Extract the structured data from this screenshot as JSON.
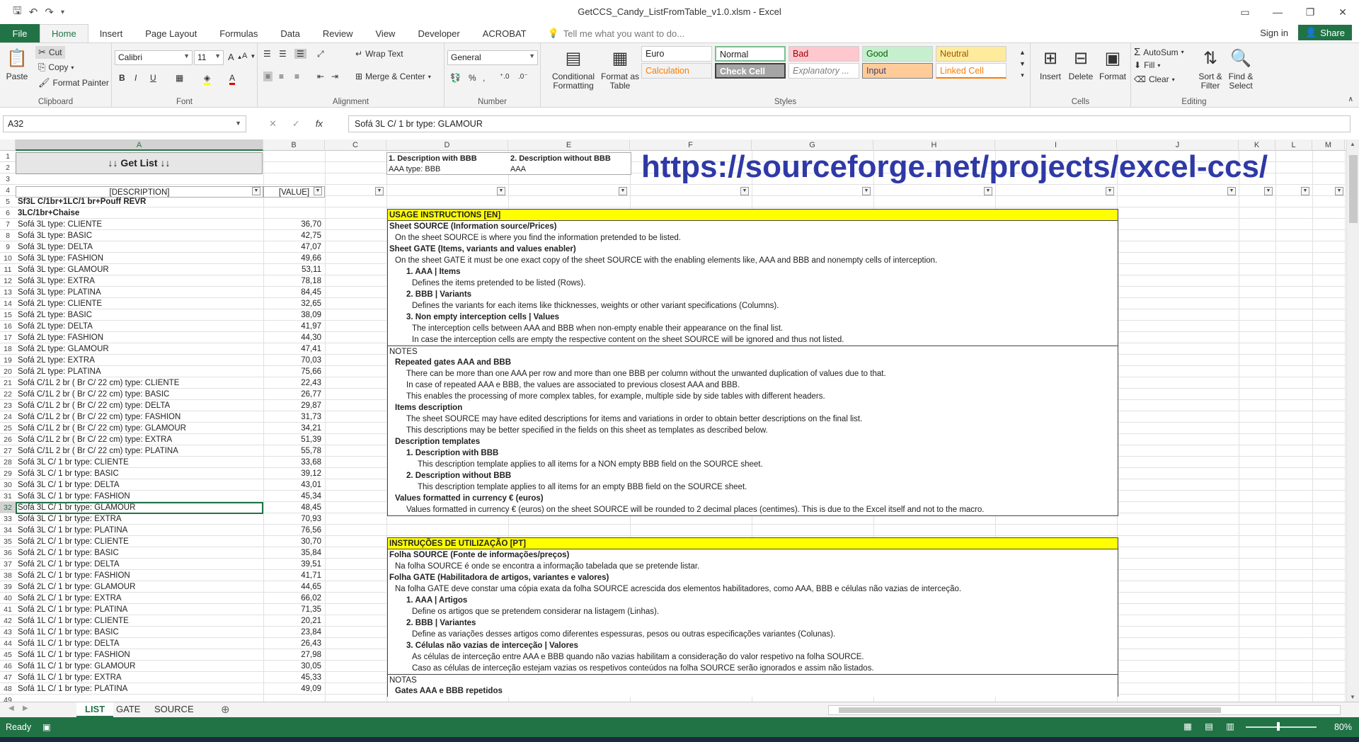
{
  "title": "GetCCS_Candy_ListFromTable_v1.0.xlsm - Excel",
  "tabs": {
    "file": "File",
    "items": [
      "Home",
      "Insert",
      "Page Layout",
      "Formulas",
      "Data",
      "Review",
      "View",
      "Developer",
      "ACROBAT"
    ],
    "tellme": "Tell me what you want to do...",
    "signin": "Sign in",
    "share": "Share"
  },
  "ribbon": {
    "clipboard": {
      "paste": "Paste",
      "cut": "Cut",
      "copy": "Copy",
      "painter": "Format Painter",
      "label": "Clipboard"
    },
    "font": {
      "name": "Calibri",
      "size": "11",
      "label": "Font"
    },
    "alignment": {
      "wrap": "Wrap Text",
      "merge": "Merge & Center",
      "label": "Alignment"
    },
    "number": {
      "format": "General",
      "label": "Number"
    },
    "styles": {
      "cond": "Conditional Formatting",
      "table": "Format as Table",
      "label": "Styles",
      "cells": [
        {
          "t": "Euro",
          "bg": "#ffffff",
          "fg": "#222222"
        },
        {
          "t": "Normal",
          "bg": "#ffffff",
          "fg": "#222222"
        },
        {
          "t": "Bad",
          "bg": "#ffc7ce",
          "fg": "#9c0006"
        },
        {
          "t": "Good",
          "bg": "#c6efce",
          "fg": "#006100"
        },
        {
          "t": "Neutral",
          "bg": "#ffeb9c",
          "fg": "#9c5700"
        },
        {
          "t": "Calculation",
          "bg": "#f2f2f2",
          "fg": "#fa7d00"
        },
        {
          "t": "Check Cell",
          "bg": "#a5a5a5",
          "fg": "#ffffff"
        },
        {
          "t": "Explanatory ...",
          "bg": "#ffffff",
          "fg": "#7f7f7f"
        },
        {
          "t": "Input",
          "bg": "#ffcc99",
          "fg": "#3f3f76"
        },
        {
          "t": "Linked Cell",
          "bg": "#ffffff",
          "fg": "#fa7d00"
        }
      ]
    },
    "cells": {
      "insert": "Insert",
      "delete": "Delete",
      "format": "Format",
      "label": "Cells"
    },
    "editing": {
      "autosum": "AutoSum",
      "fill": "Fill",
      "clear": "Clear",
      "sort": "Sort & Filter",
      "find": "Find & Select",
      "label": "Editing"
    }
  },
  "formula": {
    "namebox": "A32",
    "content": "Sofá 3L C/ 1 br type: GLAMOUR"
  },
  "columns": [
    "A",
    "B",
    "C",
    "D",
    "E",
    "F",
    "G",
    "H",
    "I",
    "J",
    "K",
    "L",
    "M"
  ],
  "header": {
    "getlist": "↓↓  Get List  ↓↓",
    "desc_label": "[DESCRIPTION]",
    "value_label": "[VALUE]",
    "d1": "1. Description with BBB",
    "d1v": "AAA type: BBB",
    "e1": "2. Description without BBB",
    "e1v": "AAA"
  },
  "url": "https://sourceforge.net/projects/excel-ccs/",
  "rows": [
    {
      "a": "Sf3L C/1br+1LC/1 br+Pouff REVR",
      "b": "",
      "bold": true
    },
    {
      "a": "3LC/1br+Chaise",
      "b": "",
      "bold": true
    },
    {
      "a": "Sofá 3L type: CLIENTE",
      "b": "36,70"
    },
    {
      "a": "Sofá 3L type: BASIC",
      "b": "42,75"
    },
    {
      "a": "Sofá 3L type: DELTA",
      "b": "47,07"
    },
    {
      "a": "Sofá 3L type: FASHION",
      "b": "49,66"
    },
    {
      "a": "Sofá 3L type: GLAMOUR",
      "b": "53,11"
    },
    {
      "a": "Sofá 3L type: EXTRA",
      "b": "78,18"
    },
    {
      "a": "Sofá 3L type: PLATINA",
      "b": "84,45"
    },
    {
      "a": "Sofá 2L type: CLIENTE",
      "b": "32,65"
    },
    {
      "a": "Sofá 2L type: BASIC",
      "b": "38,09"
    },
    {
      "a": "Sofá 2L type: DELTA",
      "b": "41,97"
    },
    {
      "a": "Sofá 2L type: FASHION",
      "b": "44,30"
    },
    {
      "a": "Sofá 2L type: GLAMOUR",
      "b": "47,41"
    },
    {
      "a": "Sofá 2L type: EXTRA",
      "b": "70,03"
    },
    {
      "a": "Sofá 2L type: PLATINA",
      "b": "75,66"
    },
    {
      "a": "Sofá C/1L 2 br ( Br C/ 22 cm) type: CLIENTE",
      "b": "22,43"
    },
    {
      "a": "Sofá C/1L 2 br ( Br C/ 22 cm) type: BASIC",
      "b": "26,77"
    },
    {
      "a": "Sofá C/1L 2 br ( Br C/ 22 cm) type: DELTA",
      "b": "29,87"
    },
    {
      "a": "Sofá C/1L 2 br ( Br C/ 22 cm) type: FASHION",
      "b": "31,73"
    },
    {
      "a": "Sofá C/1L 2 br ( Br C/ 22 cm) type: GLAMOUR",
      "b": "34,21"
    },
    {
      "a": "Sofá C/1L 2 br ( Br C/ 22 cm) type: EXTRA",
      "b": "51,39"
    },
    {
      "a": "Sofá C/1L 2 br ( Br C/ 22 cm) type: PLATINA",
      "b": "55,78"
    },
    {
      "a": "Sofá 3L C/ 1 br type: CLIENTE",
      "b": "33,68"
    },
    {
      "a": "Sofá 3L C/ 1 br type: BASIC",
      "b": "39,12"
    },
    {
      "a": "Sofá 3L C/ 1 br type: DELTA",
      "b": "43,01"
    },
    {
      "a": "Sofá 3L C/ 1 br type: FASHION",
      "b": "45,34"
    },
    {
      "a": "Sofá 3L C/ 1 br type: GLAMOUR",
      "b": "48,45"
    },
    {
      "a": "Sofá 3L C/ 1 br type: EXTRA",
      "b": "70,93"
    },
    {
      "a": "Sofá 3L C/ 1 br type: PLATINA",
      "b": "76,56"
    },
    {
      "a": "Sofá 2L C/ 1 br type: CLIENTE",
      "b": "30,70"
    },
    {
      "a": "Sofá 2L C/ 1 br type: BASIC",
      "b": "35,84"
    },
    {
      "a": "Sofá 2L C/ 1 br type: DELTA",
      "b": "39,51"
    },
    {
      "a": "Sofá 2L C/ 1 br type: FASHION",
      "b": "41,71"
    },
    {
      "a": "Sofá 2L C/ 1 br type: GLAMOUR",
      "b": "44,65"
    },
    {
      "a": "Sofá 2L C/ 1 br type: EXTRA",
      "b": "66,02"
    },
    {
      "a": "Sofá 2L C/ 1 br type: PLATINA",
      "b": "71,35"
    },
    {
      "a": "Sofá 1L C/ 1 br type: CLIENTE",
      "b": "20,21"
    },
    {
      "a": "Sofá 1L C/ 1 br type: BASIC",
      "b": "23,84"
    },
    {
      "a": "Sofá 1L C/ 1 br type: DELTA",
      "b": "26,43"
    },
    {
      "a": "Sofá 1L C/ 1 br type: FASHION",
      "b": "27,98"
    },
    {
      "a": "Sofá 1L C/ 1 br type: GLAMOUR",
      "b": "30,05"
    },
    {
      "a": "Sofá 1L C/ 1 br type: EXTRA",
      "b": "45,33"
    },
    {
      "a": "Sofá 1L C/ 1 br type: PLATINA",
      "b": "49,09"
    }
  ],
  "instructions_en": {
    "title": "USAGE INSTRUCTIONS [EN]",
    "lines": [
      {
        "t": "Sheet SOURCE (Information source/Prices)",
        "i": 0,
        "b": true
      },
      {
        "t": "On the sheet SOURCE is where you find the information pretended to be listed.",
        "i": 1
      },
      {
        "t": "Sheet GATE (Items, variants and values enabler)",
        "i": 0,
        "b": true
      },
      {
        "t": "On the sheet GATE it must be one exact copy of the sheet SOURCE with the enabling elements like, AAA and BBB and nonempty cells of interception.",
        "i": 1
      },
      {
        "t": "1. AAA | Items",
        "i": 3,
        "b": true
      },
      {
        "t": "Defines the items pretended to be listed (Rows).",
        "i": 4
      },
      {
        "t": "2. BBB | Variants",
        "i": 3,
        "b": true
      },
      {
        "t": "Defines the variants for each items like thicknesses, weights or other variant specifications (Columns).",
        "i": 4
      },
      {
        "t": "3. Non empty interception cells | Values",
        "i": 3,
        "b": true
      },
      {
        "t": "The interception cells between AAA and BBB when non-empty enable their appearance on the final list.",
        "i": 4
      },
      {
        "t": "In case the interception cells are empty the respective content on the sheet SOURCE will be ignored and thus not listed.",
        "i": 4
      },
      {
        "t": "NOTES",
        "i": 0,
        "sep": true
      },
      {
        "t": "Repeated gates AAA and BBB",
        "i": 1,
        "b": true
      },
      {
        "t": "There can be more than one AAA per row and more than one BBB per column without the unwanted duplication of values due to that.",
        "i": 3
      },
      {
        "t": "In case of repeated AAA e BBB, the values are associated to previous closest AAA and BBB.",
        "i": 3
      },
      {
        "t": "This enables the processing of more complex tables, for example, multiple side by side tables with different headers.",
        "i": 3
      },
      {
        "t": "Items description",
        "i": 1,
        "b": true
      },
      {
        "t": "The sheet SOURCE may have edited descriptions for items and variations in order to obtain better descriptions on the final list.",
        "i": 3
      },
      {
        "t": "This descriptions may be better specified in the fields on this sheet as templates as described below.",
        "i": 3
      },
      {
        "t": "Description templates",
        "i": 1,
        "b": true
      },
      {
        "t": "1. Description with BBB",
        "i": 3,
        "b": true
      },
      {
        "t": "This description template applies to all items for a NON empty BBB field on the SOURCE sheet.",
        "i": 5
      },
      {
        "t": "2. Description without BBB",
        "i": 3,
        "b": true
      },
      {
        "t": "This description template applies to all items for an empty BBB field on the SOURCE sheet.",
        "i": 5
      },
      {
        "t": "Values formatted in currency € (euros)",
        "i": 1,
        "b": true
      },
      {
        "t": "Values formatted in currency € (euros) on the sheet SOURCE will be rounded to 2 decimal places (centimes). This is due to the Excel itself and not to the macro.",
        "i": 3
      }
    ]
  },
  "instructions_pt": {
    "title": "INSTRUÇÕES DE UTILIZAÇÃO [PT]",
    "lines": [
      {
        "t": "Folha SOURCE (Fonte de informações/preços)",
        "i": 0,
        "b": true
      },
      {
        "t": "Na folha SOURCE é onde se encontra a informação tabelada que se pretende listar.",
        "i": 1
      },
      {
        "t": "Folha GATE (Habilitadora de artigos, variantes e valores)",
        "i": 0,
        "b": true
      },
      {
        "t": "Na folha GATE deve constar uma cópia exata da folha SOURCE acrescida dos elementos habilitadores, como AAA, BBB e células não vazias de interceção.",
        "i": 1
      },
      {
        "t": "1. AAA | Artigos",
        "i": 3,
        "b": true
      },
      {
        "t": "Define os artigos que se pretendem considerar na listagem (Linhas).",
        "i": 4
      },
      {
        "t": "2. BBB | Variantes",
        "i": 3,
        "b": true
      },
      {
        "t": "Define as variações desses artigos como diferentes espessuras, pesos ou outras especificações variantes (Colunas).",
        "i": 4
      },
      {
        "t": "3. Células não vazias de interceção | Valores",
        "i": 3,
        "b": true
      },
      {
        "t": "As células de interceção entre AAA e BBB quando não vazias habilitam a consideração do valor respetivo na folha SOURCE.",
        "i": 4
      },
      {
        "t": "Caso as células de interceção estejam vazias os respetivos conteúdos na folha SOURCE serão ignorados e assim não listados.",
        "i": 4
      },
      {
        "t": "NOTAS",
        "i": 0,
        "sep": true
      },
      {
        "t": "Gates AAA e BBB repetidos",
        "i": 1,
        "b": true
      }
    ]
  },
  "sheets": [
    "LIST",
    "GATE",
    "SOURCE"
  ],
  "status": {
    "ready": "Ready",
    "zoom": "80%"
  }
}
